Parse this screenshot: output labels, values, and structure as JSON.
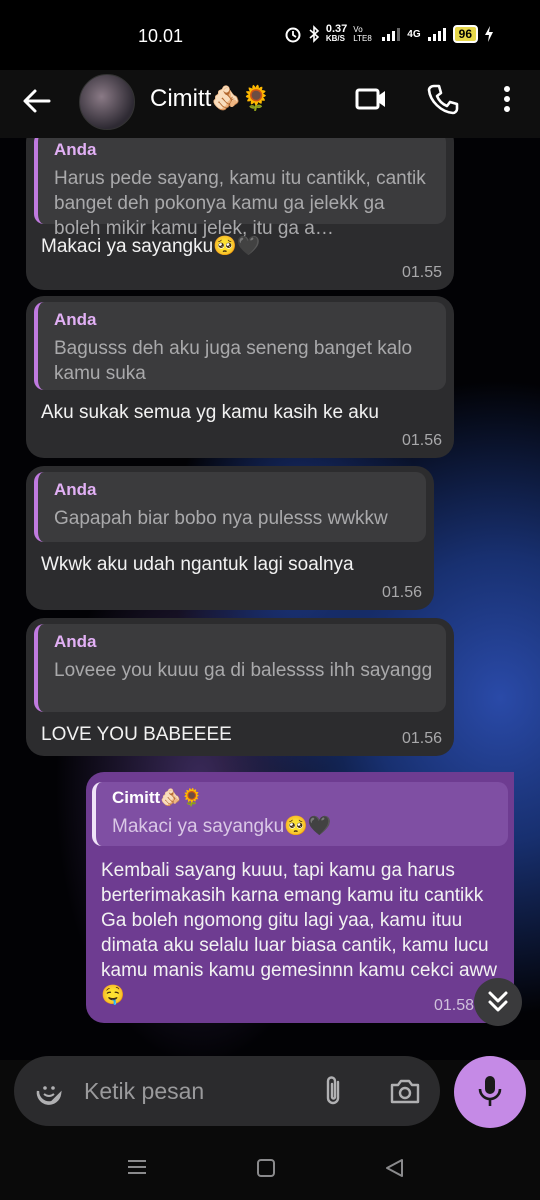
{
  "status_bar": {
    "time": "10.01",
    "net_speed": "0.37",
    "net_unit": "KB/S",
    "volte": "Vo LTE8",
    "network": "4G",
    "battery": "96"
  },
  "header": {
    "contact_name": "Cimitt🫵🏻🌻"
  },
  "messages": [
    {
      "quote_name": "Anda",
      "quote_text": "Harus pede sayang, kamu itu cantikk, cantik banget deh pokonya kamu ga jelekk ga boleh mikir kamu jelek, itu ga a…",
      "text": "Makaci ya sayangku🥺🖤",
      "time": "01.55"
    },
    {
      "quote_name": "Anda",
      "quote_text": "Bagusss deh aku juga seneng banget kalo kamu suka",
      "text": "Aku sukak semua yg kamu kasih ke aku",
      "time": "01.56"
    },
    {
      "quote_name": "Anda",
      "quote_text": "Gapapah biar bobo nya pulesss wwkkw",
      "text": "Wkwk aku udah ngantuk lagi soalnya",
      "time": "01.56"
    },
    {
      "quote_name": "Anda",
      "quote_text": "Loveee you kuuu ga di balessss ihh sayangg",
      "text": "LOVE YOU BABEEEE",
      "time": "01.56"
    }
  ],
  "sent_message": {
    "quote_name": "Cimitt🫵🏻🌻",
    "quote_text": "Makaci ya sayangku🥺🖤",
    "text": "Kembali sayang kuuu, tapi kamu ga harus berterimakasih karna emang kamu itu cantikk\nGa boleh ngomong gitu lagi yaa, kamu ituu dimata aku selalu luar biasa cantik, kamu lucu kamu manis kamu gemesinnn kamu cekci aww🤤",
    "time": "01.58",
    "status": "read"
  },
  "input": {
    "placeholder": "Ketik pesan"
  },
  "icons": {
    "back": "back-arrow-icon",
    "video": "video-call-icon",
    "phone": "phone-icon",
    "menu": "more-vert-icon",
    "sticker": "sticker-icon",
    "attach": "paperclip-icon",
    "camera": "camera-icon",
    "mic": "microphone-icon",
    "scroll": "double-chevron-down-icon"
  },
  "colors": {
    "accent": "#c58ae6",
    "sent_bubble": "#6e3c91",
    "received_bubble": "#2c2c2e",
    "quote_bar": "#c07ae0"
  }
}
